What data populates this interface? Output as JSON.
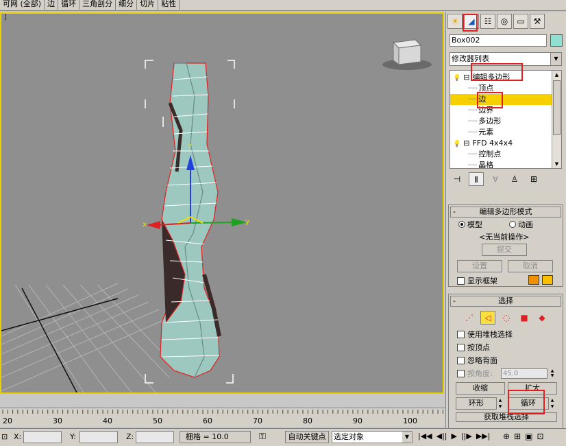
{
  "toolbar": {
    "items": [
      "可网 (全部)",
      "边",
      "循环",
      "三角剖分",
      "细分",
      "切片",
      "粘性"
    ]
  },
  "viewport": {
    "corner_label": "]",
    "axis_x": "x",
    "axis_y": "y",
    "axis_z": "z"
  },
  "panel": {
    "object_name": "Box002",
    "object_color": "#8fe0d0",
    "modifier_list": "修改器列表",
    "stack": [
      {
        "label": "编辑多边形",
        "level": 0,
        "bulb": true,
        "expand": "⊟"
      },
      {
        "label": "顶点",
        "level": 1
      },
      {
        "label": "边",
        "level": 1,
        "selected": true
      },
      {
        "label": "边界",
        "level": 1
      },
      {
        "label": "多边形",
        "level": 1
      },
      {
        "label": "元素",
        "level": 1
      },
      {
        "label": "FFD 4x4x4",
        "level": 0,
        "bulb": true,
        "expand": "⊟"
      },
      {
        "label": "控制点",
        "level": 1
      },
      {
        "label": "晶格",
        "level": 1
      }
    ],
    "edit_mode": {
      "title": "编辑多边形模式",
      "model": "模型",
      "animation": "动画",
      "no_current_op": "<无当前操作>",
      "commit": "提交",
      "settings": "设置",
      "cancel": "取消",
      "show_cage": "显示框架",
      "cage_color_1": "#f09000",
      "cage_color_2": "#f8c000"
    },
    "selection": {
      "title": "选择",
      "use_stack": "使用堆栈选择",
      "by_vertex": "按顶点",
      "ignore_backfacing": "忽略背面",
      "by_angle": "按角度:",
      "angle_value": "45.0",
      "shrink": "收缩",
      "grow": "扩大",
      "ring": "环形",
      "loop": "循环",
      "get_stack": "获取堆栈选择"
    }
  },
  "timeline": {
    "ticks": [
      "20",
      "30",
      "40",
      "50",
      "60",
      "70",
      "80",
      "90",
      "100"
    ]
  },
  "status": {
    "x_label": "X:",
    "y_label": "Y:",
    "z_label": "Z:",
    "grid": "栅格 = 10.0",
    "auto_key": "自动关键点",
    "selected_object": "选定对象"
  }
}
